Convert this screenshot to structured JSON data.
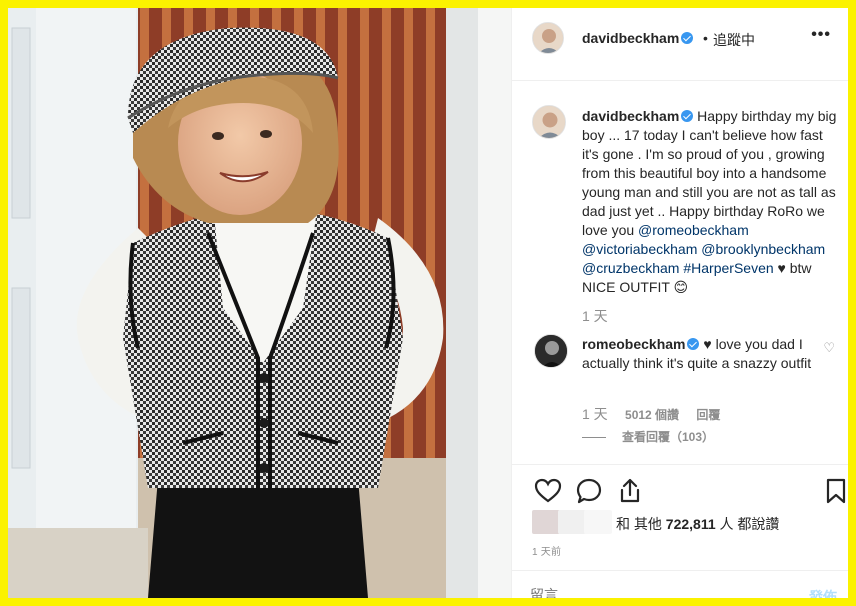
{
  "post": {
    "username": "davidbeckham",
    "dot": "•",
    "follow_status": "追蹤中",
    "more_icon": "more-horizontal-icon"
  },
  "caption": {
    "username": "davidbeckham",
    "text": "Happy birthday my big boy ... 17 today I can't believe how fast it's gone . I'm so proud of you , growing from this beautiful boy into a handsome young man and still you are not as tall as dad just yet .. Happy birthday RoRo we love you",
    "mentions": [
      "@romeobeckham",
      "@victoriabeckham",
      "@brooklynbeckham",
      "@cruzbeckham"
    ],
    "hashtag": "#HarperSeven",
    "tail": "♥ btw NICE OUTFIT 😊",
    "time": "1 天"
  },
  "comment": {
    "username": "romeobeckham",
    "text": "♥ love you dad I actually think it's quite a snazzy outfit",
    "time": "1 天",
    "likes": "5012 個讚",
    "reply_label": "回覆",
    "view_replies": "查看回覆（103）"
  },
  "likes": {
    "text_prefix": "和 其他",
    "count": "722,811",
    "text_suffix": "人 都說讚"
  },
  "post_time": "1 天前",
  "comment_box": {
    "placeholder": "留言……",
    "post_label": "發佈"
  },
  "colors": {
    "frame": "#fbf200",
    "verified": "#3897f0",
    "link": "#003569",
    "muted": "#8e8e8e",
    "post_disabled": "#b2dffc"
  }
}
